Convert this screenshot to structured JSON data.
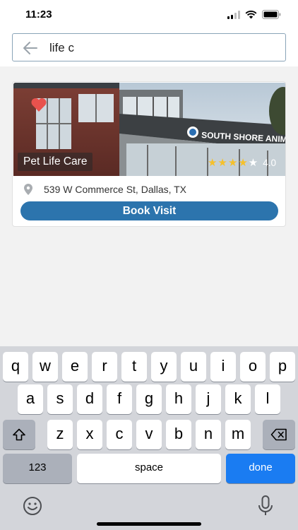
{
  "status_bar": {
    "time": "11:23"
  },
  "search": {
    "query": "life c"
  },
  "result": {
    "name": "Pet Life Care",
    "sign_text": "SOUTH SHORE ANIMAL HOS",
    "rating_value": "4.0",
    "rating": 4,
    "address": "539 W Commerce St, Dallas, TX",
    "book_label": "Book Visit",
    "favorite": true
  },
  "keyboard": {
    "row1": [
      "q",
      "w",
      "e",
      "r",
      "t",
      "y",
      "u",
      "i",
      "o",
      "p"
    ],
    "row2": [
      "a",
      "s",
      "d",
      "f",
      "g",
      "h",
      "j",
      "k",
      "l"
    ],
    "row3": [
      "z",
      "x",
      "c",
      "v",
      "b",
      "n",
      "m"
    ],
    "numbers_label": "123",
    "space_label": "space",
    "done_label": "done"
  },
  "colors": {
    "accent": "#2c74ad",
    "done_key": "#1a7cf2",
    "heart": "#e8524d",
    "star": "#f5c02b"
  }
}
